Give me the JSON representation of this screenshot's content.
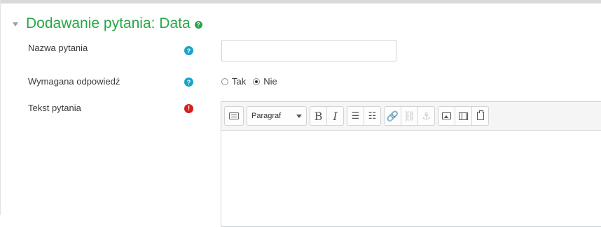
{
  "section": {
    "title": "Dodawanie pytania: Data",
    "help_glyph": "?",
    "caret_icon": "caret-down-icon"
  },
  "fields": {
    "name": {
      "label": "Nazwa pytania",
      "value": "",
      "placeholder": ""
    },
    "required": {
      "label": "Wymagana odpowiedź",
      "options": [
        "Tak",
        "Nie"
      ],
      "selected": "Nie"
    },
    "question_text": {
      "label": "Tekst pytania",
      "required_glyph": "!"
    }
  },
  "editor": {
    "format_select": "Paragraf",
    "bold": "B",
    "italic": "I",
    "bullet_list": "☰",
    "numbered_list": "☷",
    "link": "🔗",
    "unlink": "⛓",
    "anchor": "⚓"
  },
  "colors": {
    "title": "#28a745",
    "help_icon": "#1aa3c8",
    "required_icon": "#d61e1e"
  }
}
